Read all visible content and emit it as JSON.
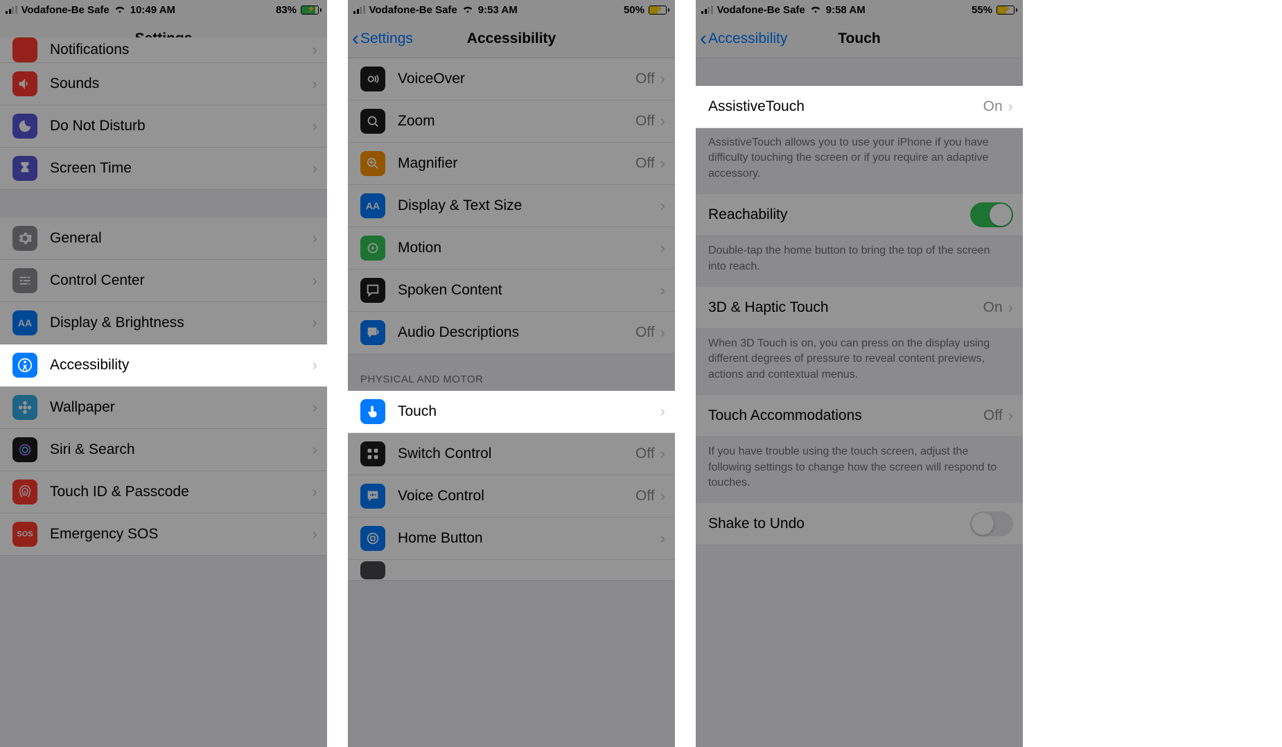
{
  "phone1": {
    "status": {
      "carrier": "Vodafone-Be Safe",
      "time": "10:49 AM",
      "battery_pct": "83%",
      "battery_fill": 83
    },
    "nav": {
      "title": "Settings"
    },
    "rows": [
      {
        "id": "notifications",
        "label": "Notifications",
        "icon": "bell",
        "bg": "ic-red"
      },
      {
        "id": "sounds",
        "label": "Sounds",
        "icon": "speaker",
        "bg": "ic-red"
      },
      {
        "id": "dnd",
        "label": "Do Not Disturb",
        "icon": "moon",
        "bg": "ic-indigo"
      },
      {
        "id": "screentime",
        "label": "Screen Time",
        "icon": "hourglass",
        "bg": "ic-indigo"
      }
    ],
    "rows2": [
      {
        "id": "general",
        "label": "General",
        "icon": "gear",
        "bg": "ic-gray"
      },
      {
        "id": "controlcenter",
        "label": "Control Center",
        "icon": "sliders",
        "bg": "ic-gray"
      },
      {
        "id": "display",
        "label": "Display & Brightness",
        "icon": "aa",
        "bg": "ic-blue"
      },
      {
        "id": "accessibility",
        "label": "Accessibility",
        "icon": "person-circle",
        "bg": "ic-blue",
        "highlight": true
      },
      {
        "id": "wallpaper",
        "label": "Wallpaper",
        "icon": "flower",
        "bg": "ic-teal"
      },
      {
        "id": "siri",
        "label": "Siri & Search",
        "icon": "siri",
        "bg": "ic-black"
      },
      {
        "id": "touchid",
        "label": "Touch ID & Passcode",
        "icon": "fingerprint",
        "bg": "ic-red"
      },
      {
        "id": "sos",
        "label": "Emergency SOS",
        "icon": "sos",
        "bg": "ic-sosred"
      }
    ]
  },
  "phone2": {
    "status": {
      "carrier": "Vodafone-Be Safe",
      "time": "9:53 AM",
      "battery_pct": "50%",
      "battery_fill": 50
    },
    "nav": {
      "back": "Settings",
      "title": "Accessibility"
    },
    "rows": [
      {
        "id": "voiceover",
        "label": "VoiceOver",
        "value": "Off",
        "icon": "voiceover",
        "bg": "ic-black"
      },
      {
        "id": "zoom",
        "label": "Zoom",
        "value": "Off",
        "icon": "zoom",
        "bg": "ic-black"
      },
      {
        "id": "magnifier",
        "label": "Magnifier",
        "value": "Off",
        "icon": "magnifier",
        "bg": "ic-orange"
      },
      {
        "id": "displaytext",
        "label": "Display & Text Size",
        "icon": "aa",
        "bg": "ic-blue"
      },
      {
        "id": "motion",
        "label": "Motion",
        "icon": "motion",
        "bg": "ic-green"
      },
      {
        "id": "spoken",
        "label": "Spoken Content",
        "icon": "speech",
        "bg": "ic-black"
      },
      {
        "id": "audiodesc",
        "label": "Audio Descriptions",
        "value": "Off",
        "icon": "audio",
        "bg": "ic-blue"
      }
    ],
    "section_header": "PHYSICAL AND MOTOR",
    "rows2": [
      {
        "id": "touch",
        "label": "Touch",
        "icon": "hand",
        "bg": "ic-blue",
        "highlight": true
      },
      {
        "id": "switchcontrol",
        "label": "Switch Control",
        "value": "Off",
        "icon": "switch",
        "bg": "ic-black"
      },
      {
        "id": "voicecontrol",
        "label": "Voice Control",
        "value": "Off",
        "icon": "voice",
        "bg": "ic-blue"
      },
      {
        "id": "homebutton",
        "label": "Home Button",
        "icon": "home",
        "bg": "ic-blue"
      }
    ]
  },
  "phone3": {
    "status": {
      "carrier": "Vodafone-Be Safe",
      "time": "9:58 AM",
      "battery_pct": "55%",
      "battery_fill": 55
    },
    "nav": {
      "back": "Accessibility",
      "title": "Touch"
    },
    "items": {
      "assistive": {
        "label": "AssistiveTouch",
        "value": "On",
        "highlight": true
      },
      "assistive_footer": "AssistiveTouch allows you to use your iPhone if you have difficulty touching the screen or if you require an adaptive accessory.",
      "reachability": {
        "label": "Reachability",
        "toggle": "on"
      },
      "reachability_footer": "Double-tap the home button to bring the top of the screen into reach.",
      "haptic": {
        "label": "3D & Haptic Touch",
        "value": "On"
      },
      "haptic_footer": "When 3D Touch is on, you can press on the display using different degrees of pressure to reveal content previews, actions and contextual menus.",
      "accommodations": {
        "label": "Touch Accommodations",
        "value": "Off"
      },
      "accommodations_footer": "If you have trouble using the touch screen, adjust the following settings to change how the screen will respond to touches.",
      "shake": {
        "label": "Shake to Undo",
        "toggle": "off"
      }
    }
  }
}
